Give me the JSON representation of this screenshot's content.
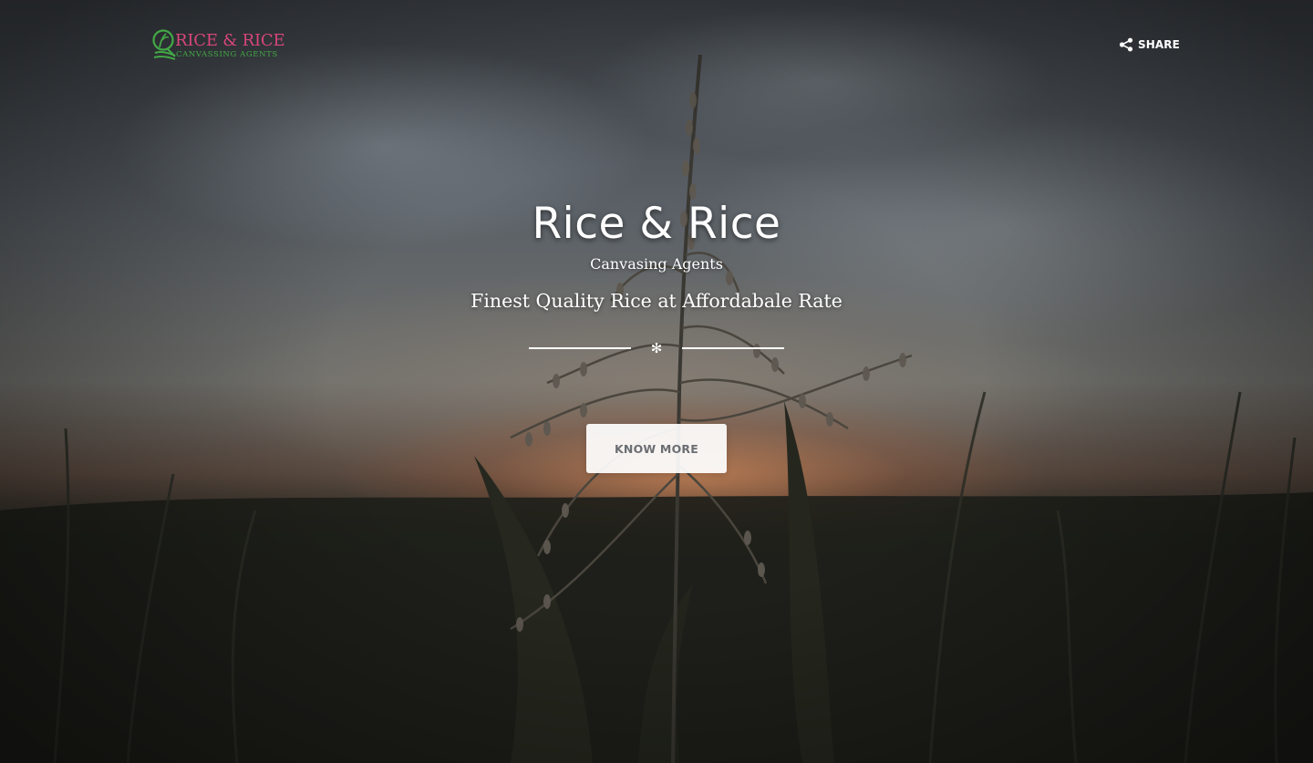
{
  "brand": {
    "logo_title": "RICE & RICE",
    "logo_subtitle": "CANVASSING AGENTS",
    "title_color": "#d8457a",
    "subtitle_color": "#43a846"
  },
  "header": {
    "share_label": "SHARE",
    "share_icon": "share-icon"
  },
  "hero": {
    "title": "Rice & Rice",
    "subtitle": "Canvasing Agents",
    "tagline": "Finest Quality Rice at Affordabale Rate",
    "divider_ornament": "✻",
    "cta_label": "KNOW MORE",
    "background": "rice-plant-at-dusk-image"
  }
}
